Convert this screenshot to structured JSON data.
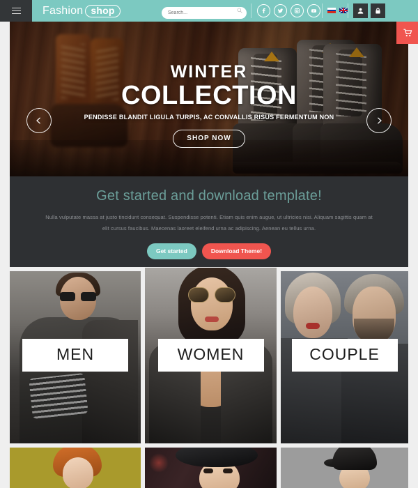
{
  "header": {
    "menu_icon": "hamburger-menu-icon",
    "logo_text": "Fashion",
    "logo_badge": "shop",
    "search": {
      "value": "",
      "placeholder": "Search...",
      "icon": "search-icon"
    },
    "socials": [
      {
        "name": "facebook-icon",
        "glyph": "f"
      },
      {
        "name": "twitter-icon",
        "glyph": "t"
      },
      {
        "name": "instagram-icon",
        "glyph": "i"
      },
      {
        "name": "youtube-icon",
        "glyph": "y"
      }
    ],
    "languages": [
      {
        "name": "flag-russia",
        "label": "RU"
      },
      {
        "name": "flag-uk",
        "label": "EN"
      }
    ],
    "account_buttons": [
      {
        "name": "user-account-icon",
        "label": "Account"
      },
      {
        "name": "lock-login-icon",
        "label": "Login"
      }
    ]
  },
  "hero": {
    "title_line1": "WINTER",
    "title_line2": "COLLECTION",
    "subtitle": "PENDISSE BLANDIT LIGULA TURPIS, AC CONVALLIS RISUS FERMENTUM NON",
    "cta_label": "SHOP NOW",
    "prev_label": "Previous slide",
    "next_label": "Next slide",
    "cart_label": "Cart"
  },
  "promo": {
    "heading": "Get started and download template!",
    "paragraph": "Nulla vulputate massa at justo tincidunt consequat. Suspendisse potenti. Etiam quis enim augue, ut ultricies nisi. Aliquam sagittis quam at elit cursus faucibus. Maecenas laoreet eleifend urna ac adipiscing. Aenean eu tellus urna.",
    "button_primary": "Get started",
    "button_secondary": "Download Theme!"
  },
  "categories": {
    "men": "MEN",
    "women": "WOMEN",
    "couple": "COUPLE",
    "kid": "",
    "hat": "",
    "cap": ""
  },
  "colors": {
    "teal": "#7cc9c1",
    "coral": "#f0554f",
    "dark": "#2e3033",
    "header_dark": "#333638",
    "heading_teal": "#6b9e99"
  }
}
